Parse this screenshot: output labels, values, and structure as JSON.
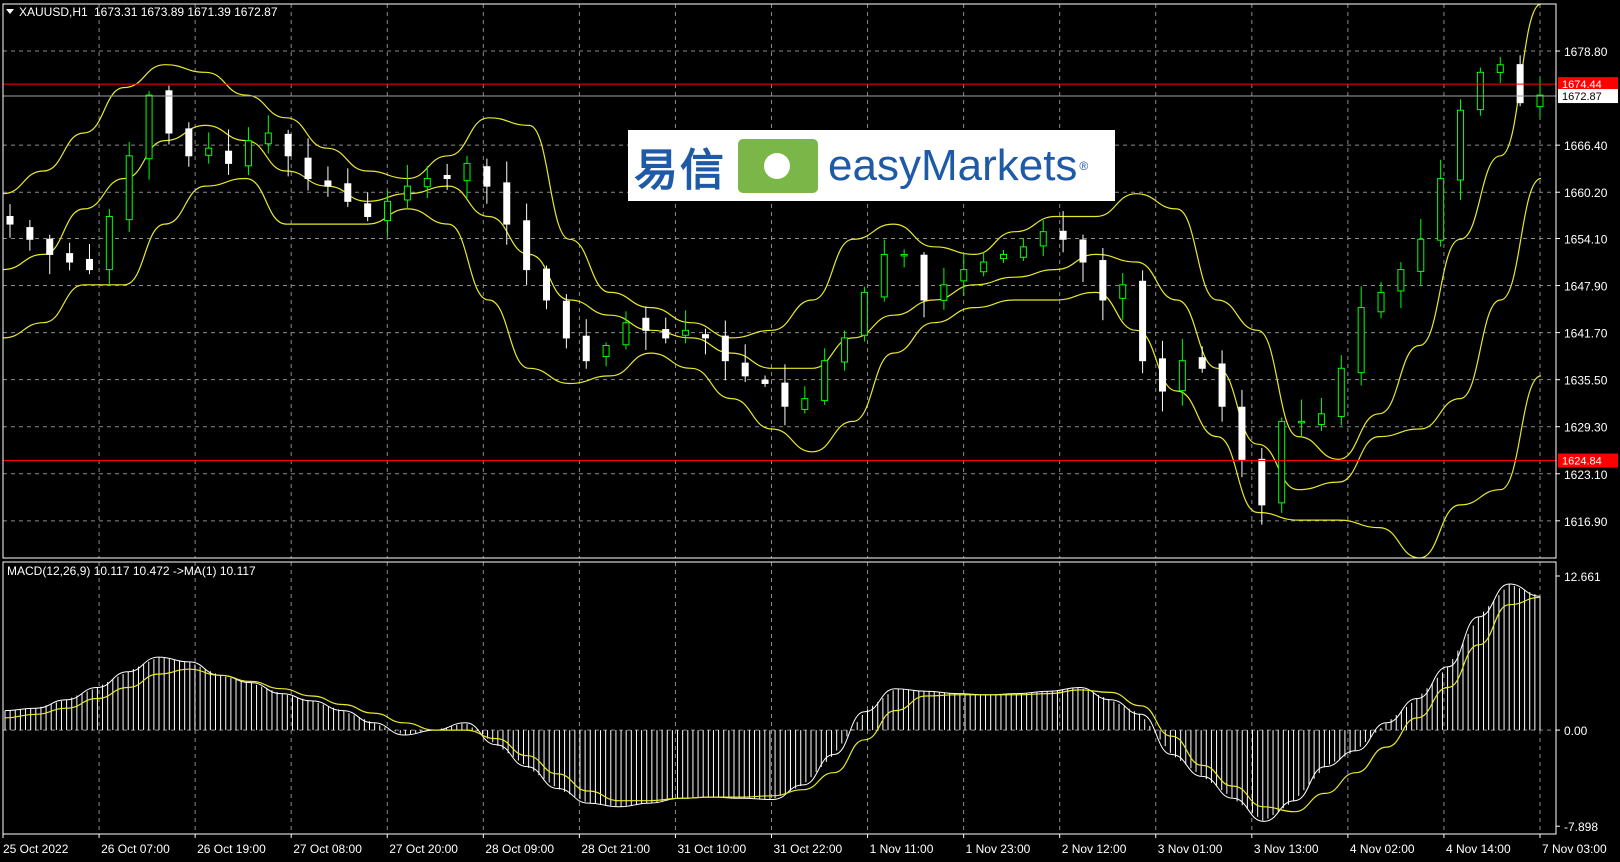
{
  "header": {
    "symbol": "XAUUSD,H1",
    "ohlc": "1673.31 1673.89 1671.39 1672.87"
  },
  "macd_header": "MACD(12,26,9) 10.117 10.472  ->MA(1) 10.117",
  "watermark": {
    "cn": "易信",
    "en": "easyMarkets",
    "reg": "®"
  },
  "colors": {
    "background": "#000000",
    "grid": "#8a8a8a",
    "bull": "#00ff00",
    "bear": "#ffffff",
    "bands": "#e8e82a",
    "hline": "#ff0000",
    "histogram": "#ffffff",
    "signal": "#e8e82a"
  },
  "chart_data": [
    {
      "type": "candlestick",
      "ylim": [
        1612.0,
        1685.0
      ],
      "price_ticks": [
        "1678.80",
        "1666.40",
        "1660.20",
        "1654.10",
        "1647.90",
        "1641.70",
        "1635.50",
        "1629.30",
        "1623.10",
        "1616.90"
      ],
      "time_ticks": [
        "25 Oct 2022",
        "26 Oct 07:00",
        "26 Oct 19:00",
        "27 Oct 08:00",
        "27 Oct 20:00",
        "28 Oct 09:00",
        "28 Oct 21:00",
        "31 Oct 10:00",
        "31 Oct 22:00",
        "1 Nov 11:00",
        "1 Nov 23:00",
        "2 Nov 12:00",
        "3 Nov 01:00",
        "3 Nov 13:00",
        "4 Nov 02:00",
        "4 Nov 14:00",
        "7 Nov 03:00"
      ],
      "horizontal_lines": [
        {
          "price": 1674.44,
          "label": "1674.44"
        },
        {
          "price": 1624.84,
          "label": "1624.84"
        }
      ],
      "current_price": {
        "price": 1672.87,
        "label": "1672.87"
      },
      "bollinger": {
        "upper": [
          1660,
          1663,
          1668,
          1674,
          1677,
          1676,
          1673,
          1670,
          1666,
          1663,
          1662,
          1665,
          1670,
          1669,
          1654,
          1647,
          1645,
          1643,
          1641,
          1642,
          1646,
          1654,
          1656,
          1653,
          1652,
          1655,
          1657,
          1657,
          1660,
          1658,
          1646,
          1642,
          1628,
          1625,
          1631,
          1640,
          1654,
          1665,
          1685
        ],
        "middle": [
          1650,
          1652,
          1658,
          1662,
          1667,
          1669,
          1667,
          1663,
          1661,
          1659,
          1660,
          1661,
          1657,
          1652,
          1646,
          1644,
          1642,
          1641,
          1639,
          1637,
          1637,
          1641,
          1644,
          1646,
          1648,
          1649,
          1650,
          1652,
          1651,
          1646,
          1637,
          1627,
          1621,
          1622,
          1628,
          1629,
          1633,
          1646,
          1662
        ],
        "lower": [
          1641,
          1643,
          1648,
          1648,
          1656,
          1661,
          1662,
          1656,
          1656,
          1656,
          1658,
          1656,
          1646,
          1637,
          1635,
          1636,
          1639,
          1637,
          1633,
          1629,
          1626,
          1630,
          1639,
          1643,
          1645,
          1646,
          1646,
          1647,
          1642,
          1634,
          1628,
          1618,
          1617,
          1617,
          1616,
          1612,
          1619,
          1621,
          1636
        ]
      },
      "candles_close": [
        1656,
        1654,
        1652,
        1651,
        1650,
        1657,
        1665,
        1673,
        1668,
        1665,
        1666,
        1664,
        1667,
        1668,
        1665,
        1662,
        1661,
        1659,
        1657,
        1659,
        1661,
        1662,
        1662,
        1664,
        1661,
        1656,
        1650,
        1646,
        1641,
        1638,
        1640,
        1643,
        1642,
        1641,
        1642,
        1641,
        1638,
        1636,
        1635,
        1632,
        1633,
        1638,
        1641,
        1647,
        1652,
        1652,
        1646,
        1648,
        1650,
        1651,
        1652,
        1653,
        1655,
        1654,
        1651,
        1646,
        1648,
        1638,
        1634,
        1638,
        1637,
        1632,
        1625,
        1619,
        1630,
        1630,
        1631,
        1637,
        1645,
        1647,
        1650,
        1654,
        1662,
        1671,
        1676,
        1677,
        1672,
        1673
      ]
    },
    {
      "type": "bar",
      "name": "MACD(12,26,9)",
      "ylim": [
        -7.898,
        12.661
      ],
      "ticks": [
        "12.661",
        "0.00",
        "-7.898"
      ],
      "histogram": [
        1.6,
        1.8,
        2.5,
        3.5,
        4.8,
        6.0,
        5.6,
        4.5,
        3.9,
        3.0,
        2.4,
        1.6,
        0.6,
        -0.4,
        0.0,
        0.6,
        -1.2,
        -3.0,
        -4.8,
        -6.0,
        -6.3,
        -6.0,
        -5.6,
        -5.5,
        -5.6,
        -5.7,
        -4.5,
        -2.0,
        1.5,
        3.4,
        3.2,
        3.0,
        2.9,
        3.0,
        3.2,
        3.5,
        2.5,
        1.3,
        -2.0,
        -3.8,
        -5.6,
        -7.5,
        -5.8,
        -3.0,
        -1.7,
        0.6,
        2.6,
        5.2,
        9.3,
        12.0,
        11.0
      ],
      "signal": [
        1.0,
        1.3,
        1.8,
        2.6,
        3.5,
        4.6,
        5.0,
        4.5,
        4.0,
        3.4,
        2.8,
        2.1,
        1.4,
        0.6,
        0.0,
        0.0,
        -0.7,
        -2.1,
        -3.6,
        -5.0,
        -5.8,
        -5.8,
        -5.6,
        -5.5,
        -5.5,
        -5.4,
        -4.9,
        -3.5,
        -0.8,
        1.6,
        2.8,
        2.9,
        2.9,
        2.9,
        3.0,
        3.3,
        3.1,
        2.0,
        -0.5,
        -2.9,
        -4.6,
        -6.3,
        -6.7,
        -5.2,
        -3.5,
        -1.4,
        1.0,
        3.5,
        7.0,
        10.3,
        10.9
      ]
    }
  ]
}
